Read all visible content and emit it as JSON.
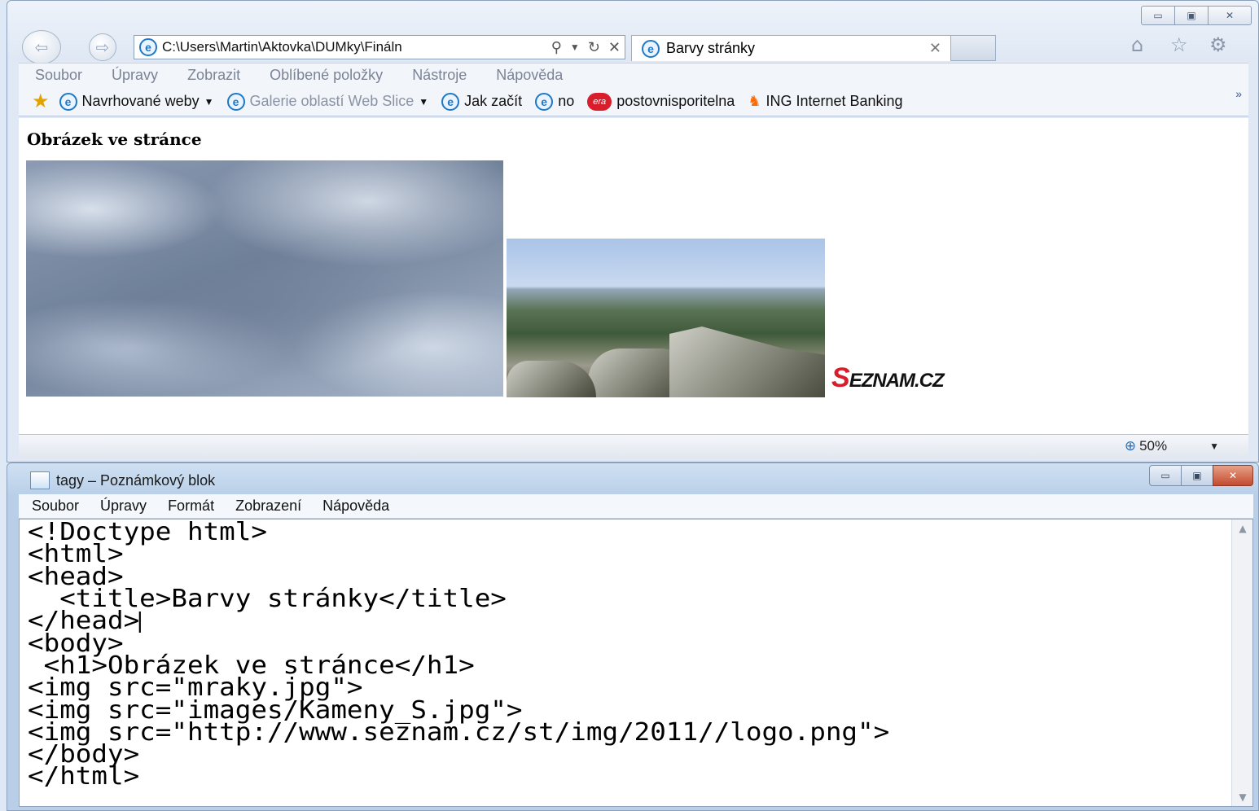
{
  "browser": {
    "address": "C:\\Users\\Martin\\Aktovka\\DUMky\\Fináln",
    "tab_title": "Barvy stránky",
    "menu": [
      "Soubor",
      "Úpravy",
      "Zobrazit",
      "Oblíbené položky",
      "Nástroje",
      "Nápověda"
    ],
    "favorites": [
      {
        "label": "Navrhované weby",
        "dropdown": true
      },
      {
        "label": "Galerie oblastí Web Slice",
        "dropdown": true
      },
      {
        "label": "Jak začít"
      },
      {
        "label": "no"
      },
      {
        "label": "postovnisporitelna"
      },
      {
        "label": "ING Internet Banking"
      }
    ],
    "era_badge": "era",
    "page_heading": "Obrázek ve stránce",
    "logo_initial": "S",
    "logo_rest": "EZNAM.CZ",
    "zoom": "50%"
  },
  "notepad": {
    "title": "tagy – Poznámkový blok",
    "menu": [
      "Soubor",
      "Úpravy",
      "Formát",
      "Zobrazení",
      "Nápověda"
    ],
    "code_lines": [
      "<!Doctype html>",
      "<html>",
      "<head>",
      "  <title>Barvy stránky</title>",
      "</head>",
      "<body>",
      " <h1>Obrázek ve stránce</h1>",
      "<img src=\"mraky.jpg\">",
      "<img src=\"images/Kameny_S.jpg\">",
      "<img src=\"http://www.seznam.cz/st/img/2011//logo.png\">",
      "</body>",
      "</html>"
    ]
  },
  "colors": {
    "ie_blue": "#1f78c8",
    "seznam_red": "#d81e2c",
    "close_red": "#c44a2e"
  }
}
